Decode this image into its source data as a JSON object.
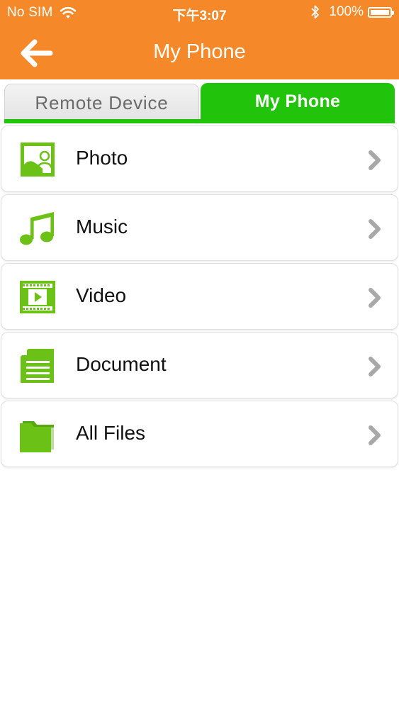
{
  "status_bar": {
    "carrier": "No SIM",
    "time": "下午3:07",
    "battery_percent": "100%",
    "battery_level": 1.0
  },
  "nav": {
    "title": "My Phone",
    "back_icon": "back-arrow-icon"
  },
  "tabs": [
    {
      "label": "Remote Device",
      "selected": false
    },
    {
      "label": "My Phone",
      "selected": true
    }
  ],
  "list": [
    {
      "label": "Photo",
      "icon": "photo-icon"
    },
    {
      "label": "Music",
      "icon": "music-note-icon"
    },
    {
      "label": "Video",
      "icon": "video-film-icon"
    },
    {
      "label": "Document",
      "icon": "document-icon"
    },
    {
      "label": "All Files",
      "icon": "folder-icon"
    }
  ],
  "colors": {
    "header": "#f5892a",
    "accent_green": "#22c40b",
    "icon_green": "#6cc117",
    "chevron": "#a8a8a8"
  }
}
